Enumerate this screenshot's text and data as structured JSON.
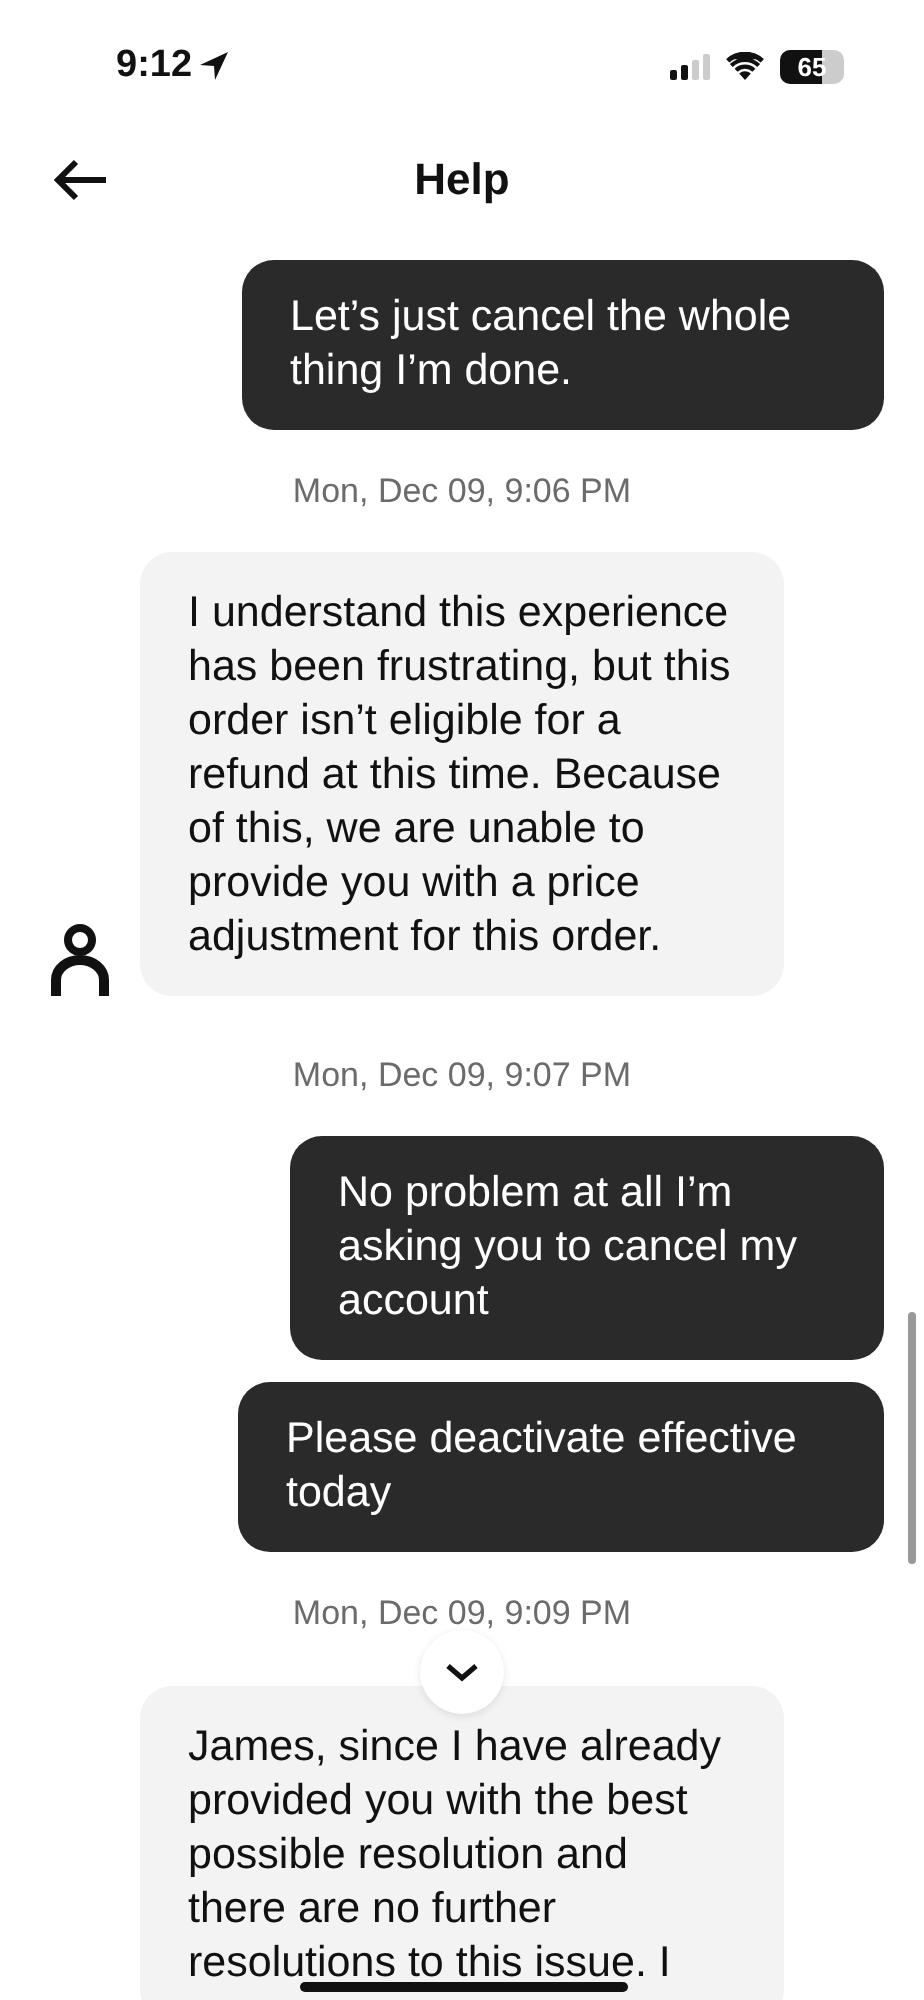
{
  "status_bar": {
    "time": "9:12",
    "battery": "65"
  },
  "header": {
    "title": "Help"
  },
  "messages": [
    {
      "kind": "sent",
      "text": "Let’s just cancel the whole thing I’m done."
    },
    {
      "kind": "timestamp",
      "text": "Mon, Dec 09, 9:06 PM"
    },
    {
      "kind": "received",
      "text": " I understand this experience has been frustrating, but this order isn’t eligible for a refund at this time. Because of this, we are unable to provide you with a price adjustment for this order.",
      "avatar": true
    },
    {
      "kind": "timestamp",
      "text": "Mon, Dec 09, 9:07 PM"
    },
    {
      "kind": "sent",
      "text": "No problem at all I’m asking you to cancel my account"
    },
    {
      "kind": "sent",
      "text": "Please deactivate effective today"
    },
    {
      "kind": "timestamp",
      "text": "Mon, Dec 09, 9:09 PM"
    },
    {
      "kind": "received",
      "text": "James, since I have already provided you with the best possible resolution and there are no further resolutions to this issue. I",
      "avatar": false
    }
  ]
}
